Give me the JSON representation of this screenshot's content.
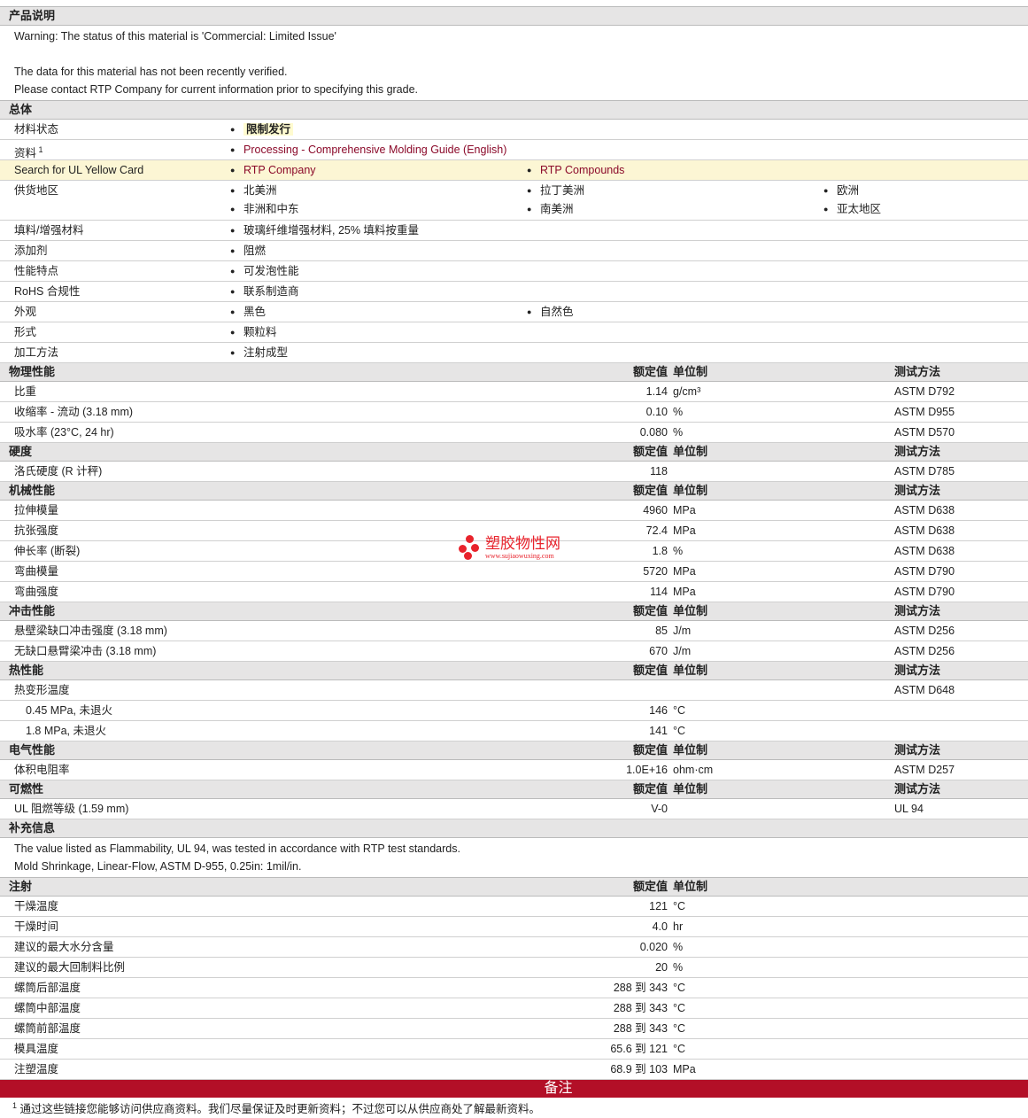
{
  "description": {
    "title": "产品说明",
    "lines": [
      "Warning: The status of this material is 'Commercial: Limited Issue'",
      "",
      "The data for this material has not been recently verified.",
      "Please contact RTP Company for current information prior to specifying this grade."
    ]
  },
  "general": {
    "title": "总体",
    "rows": [
      {
        "label": "材料状态",
        "items": [
          {
            "text": "限制发行",
            "style": "tag"
          }
        ]
      },
      {
        "label": "资料",
        "sup": "1",
        "items": [
          {
            "text": "Processing - Comprehensive Molding Guide (English)",
            "style": "link"
          }
        ]
      },
      {
        "label": "Search for UL Yellow Card",
        "highlight": true,
        "items": [
          {
            "text": "RTP Company",
            "style": "link"
          },
          {
            "text": "RTP Compounds",
            "style": "link"
          }
        ]
      },
      {
        "label": "供货地区",
        "items": [
          {
            "text": "北美洲"
          },
          {
            "text": "拉丁美洲"
          },
          {
            "text": "欧洲"
          },
          {
            "text": "非洲和中东"
          },
          {
            "text": "南美洲"
          },
          {
            "text": "亚太地区"
          }
        ]
      },
      {
        "label": "填料/增强材料",
        "items": [
          {
            "text": "玻璃纤维增强材料, 25% 填料按重量"
          }
        ]
      },
      {
        "label": "添加剂",
        "items": [
          {
            "text": "阻燃"
          }
        ]
      },
      {
        "label": "性能特点",
        "items": [
          {
            "text": "可发泡性能"
          }
        ]
      },
      {
        "label": "RoHS 合规性",
        "items": [
          {
            "text": "联系制造商"
          }
        ]
      },
      {
        "label": "外观",
        "items": [
          {
            "text": "黑色"
          },
          {
            "text": "自然色"
          }
        ]
      },
      {
        "label": "形式",
        "items": [
          {
            "text": "颗粒料"
          }
        ]
      },
      {
        "label": "加工方法",
        "items": [
          {
            "text": "注射成型"
          }
        ]
      }
    ]
  },
  "col_headers": {
    "value": "额定值",
    "unit": "单位制",
    "method": "测试方法"
  },
  "sections": [
    {
      "title": "物理性能",
      "rows": [
        [
          "比重",
          "1.14",
          "g/cm³",
          "ASTM D792"
        ],
        [
          "收缩率 - 流动 (3.18 mm)",
          "0.10",
          "%",
          "ASTM D955"
        ],
        [
          "吸水率 (23°C, 24 hr)",
          "0.080",
          "%",
          "ASTM D570"
        ]
      ]
    },
    {
      "title": "硬度",
      "rows": [
        [
          "洛氏硬度 (R 计秤)",
          "118",
          "",
          "ASTM D785"
        ]
      ]
    },
    {
      "title": "机械性能",
      "rows": [
        [
          "拉伸模量",
          "4960",
          "MPa",
          "ASTM D638"
        ],
        [
          "抗张强度",
          "72.4",
          "MPa",
          "ASTM D638"
        ],
        [
          "伸长率 (断裂)",
          "1.8",
          "%",
          "ASTM D638"
        ],
        [
          "弯曲模量",
          "5720",
          "MPa",
          "ASTM D790"
        ],
        [
          "弯曲强度",
          "114",
          "MPa",
          "ASTM D790"
        ]
      ]
    },
    {
      "title": "冲击性能",
      "rows": [
        [
          "悬壁梁缺口冲击强度 (3.18 mm)",
          "85",
          "J/m",
          "ASTM D256"
        ],
        [
          "无缺口悬臂梁冲击 (3.18 mm)",
          "670",
          "J/m",
          "ASTM D256"
        ]
      ]
    },
    {
      "title": "热性能",
      "rows": [
        [
          "热变形温度",
          "",
          "",
          "ASTM D648"
        ],
        [
          "0.45 MPa, 未退火",
          "146",
          "°C",
          "",
          true
        ],
        [
          "1.8 MPa, 未退火",
          "141",
          "°C",
          "",
          true
        ]
      ]
    },
    {
      "title": "电气性能",
      "rows": [
        [
          "体积电阻率",
          "1.0E+16",
          "ohm·cm",
          "ASTM D257"
        ]
      ]
    },
    {
      "title": "可燃性",
      "rows": [
        [
          "UL 阻燃等级 (1.59 mm)",
          "V-0",
          "",
          "UL 94"
        ]
      ]
    }
  ],
  "supplement": {
    "title": "补充信息",
    "lines": [
      "The value listed as Flammability, UL 94, was tested in accordance with RTP test standards.",
      "Mold Shrinkage, Linear-Flow, ASTM D-955, 0.25in: 1mil/in."
    ]
  },
  "injection": {
    "title": "注射",
    "rows": [
      [
        "干燥温度",
        "121",
        "°C"
      ],
      [
        "干燥时间",
        "4.0",
        "hr"
      ],
      [
        "建议的最大水分含量",
        "0.020",
        "%"
      ],
      [
        "建议的最大回制料比例",
        "20",
        "%"
      ],
      [
        "螺筒后部温度",
        "288 到  343",
        "°C"
      ],
      [
        "螺筒中部温度",
        "288 到  343",
        "°C"
      ],
      [
        "螺筒前部温度",
        "288 到  343",
        "°C"
      ],
      [
        "模具温度",
        "65.6 到  121",
        "°C"
      ],
      [
        "注塑温度",
        "68.9 到  103",
        "MPa"
      ]
    ]
  },
  "notes": {
    "title": "备注",
    "sup": "1",
    "text": "通过这些链接您能够访问供应商资料。我们尽量保证及时更新资料；不过您可以从供应商处了解最新资料。"
  },
  "logo": {
    "name": "塑胶物性网",
    "url": "www.sujiaowuxing.com"
  }
}
